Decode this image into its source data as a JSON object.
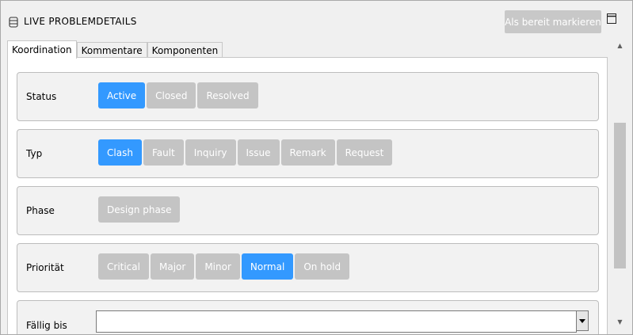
{
  "header": {
    "title": "LIVE PROBLEMDETAILS",
    "mark_ready_label": "Als bereit markieren"
  },
  "tabs": [
    {
      "label": "Koordination",
      "active": true
    },
    {
      "label": "Kommentare",
      "active": false
    },
    {
      "label": "Komponenten",
      "active": false
    }
  ],
  "sections": {
    "status": {
      "label": "Status",
      "options": [
        "Active",
        "Closed",
        "Resolved"
      ],
      "selected": "Active"
    },
    "typ": {
      "label": "Typ",
      "options": [
        "Clash",
        "Fault",
        "Inquiry",
        "Issue",
        "Remark",
        "Request"
      ],
      "selected": "Clash"
    },
    "phase": {
      "label": "Phase",
      "options": [
        "Design phase"
      ],
      "selected": ""
    },
    "prioritaet": {
      "label": "Priorität",
      "options": [
        "Critical",
        "Major",
        "Minor",
        "Normal",
        "On hold"
      ],
      "selected": "Normal"
    },
    "faellig": {
      "label": "Fällig bis",
      "value": ""
    }
  },
  "colors": {
    "selected_chip": "#3399ff",
    "unselected_chip": "#c4c4c4",
    "disabled_button": "#c8c8c8"
  },
  "icons": {
    "title": "database-icon",
    "window": "window-restore-icon",
    "dropdown": "chevron-down-icon"
  }
}
